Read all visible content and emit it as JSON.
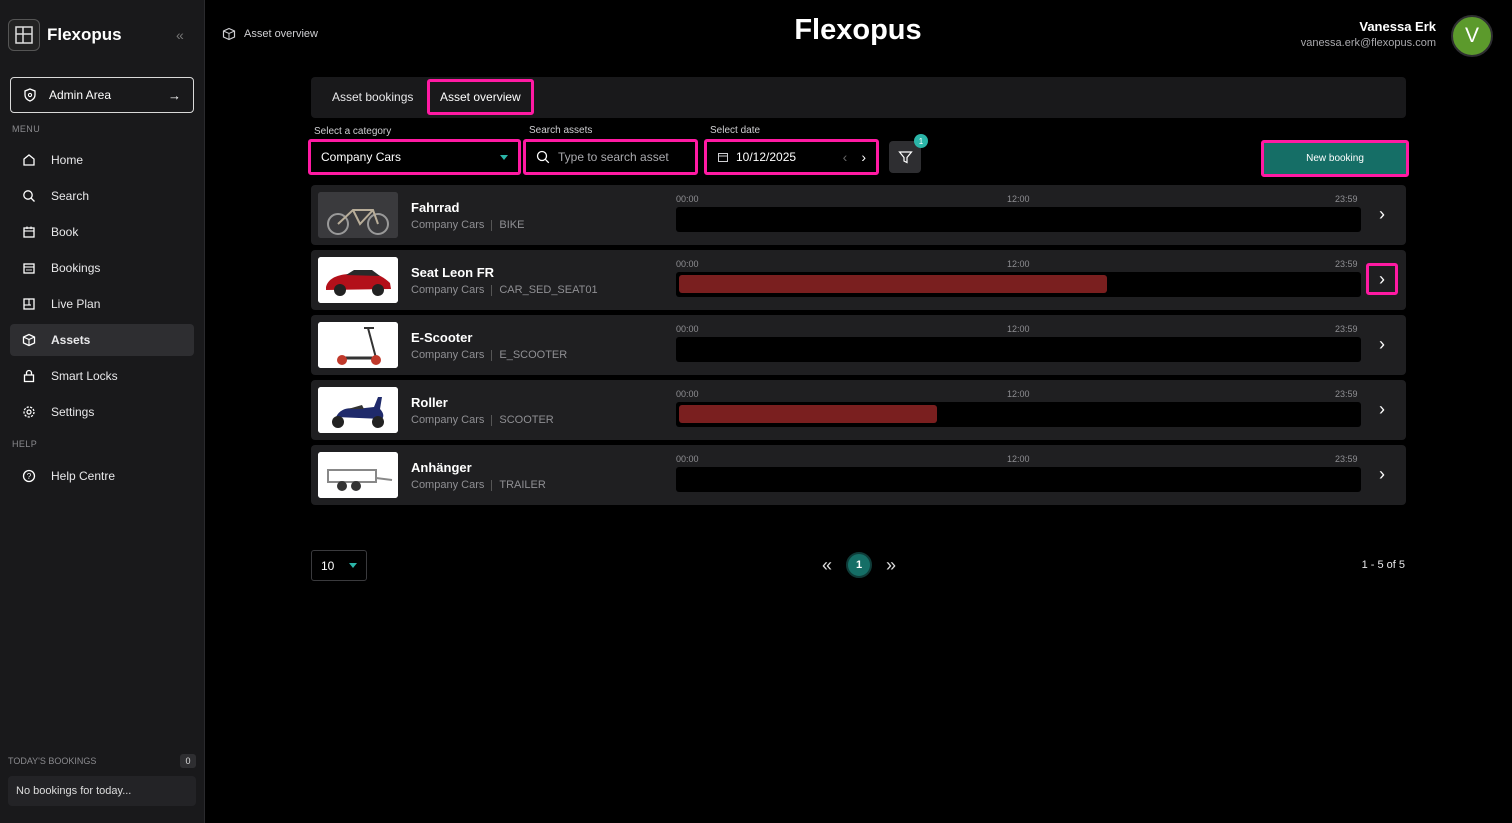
{
  "sidebar": {
    "brand": "Flexopus",
    "admin_label": "Admin Area",
    "menu_label": "MENU",
    "help_label": "HELP",
    "items": [
      {
        "label": "Home",
        "icon": "home-icon"
      },
      {
        "label": "Search",
        "icon": "search-icon"
      },
      {
        "label": "Book",
        "icon": "calendar-plus-icon"
      },
      {
        "label": "Bookings",
        "icon": "calendar-icon"
      },
      {
        "label": "Live Plan",
        "icon": "floorplan-icon"
      },
      {
        "label": "Assets",
        "icon": "box-icon",
        "active": true
      },
      {
        "label": "Smart Locks",
        "icon": "lock-icon"
      },
      {
        "label": "Settings",
        "icon": "gear-icon"
      }
    ],
    "help_item": "Help Centre",
    "todays_bookings_label": "TODAY'S BOOKINGS",
    "todays_bookings_count": "0",
    "no_bookings": "No bookings for today..."
  },
  "header": {
    "breadcrumb": "Asset overview",
    "title": "Flexopus",
    "user_name": "Vanessa Erk",
    "user_email": "vanessa.erk@flexopus.com",
    "avatar_initial": "V"
  },
  "tabs": [
    {
      "label": "Asset bookings"
    },
    {
      "label": "Asset overview",
      "active": true
    }
  ],
  "filters": {
    "category_label": "Select a category",
    "category_value": "Company Cars",
    "search_label": "Search assets",
    "search_placeholder": "Type to search asset",
    "date_label": "Select date",
    "date_value": "10/12/2025",
    "filter_badge": "1",
    "new_booking": "New booking"
  },
  "timeline_labels": {
    "start": "00:00",
    "mid": "12:00",
    "end": "23:59"
  },
  "assets": [
    {
      "name": "Fahrrad",
      "category": "Company Cars",
      "code": "BIKE",
      "booking": null
    },
    {
      "name": "Seat Leon FR",
      "category": "Company Cars",
      "code": "CAR_SED_SEAT01",
      "booking": {
        "start_fraction": 0.0,
        "end_fraction": 0.63
      }
    },
    {
      "name": "E-Scooter",
      "category": "Company Cars",
      "code": "E_SCOOTER",
      "booking": null
    },
    {
      "name": "Roller",
      "category": "Company Cars",
      "code": "SCOOTER",
      "booking": {
        "start_fraction": 0.0,
        "end_fraction": 0.38
      }
    },
    {
      "name": "Anhänger",
      "category": "Company Cars",
      "code": "TRAILER",
      "booking": null
    }
  ],
  "pagination": {
    "per_page": "10",
    "current_page": "1",
    "range": "1 - 5 of 5"
  },
  "colors": {
    "accent": "#156e66",
    "highlight": "#ff1aa3",
    "booking_bar": "#7a1f1f",
    "avatar": "#5c9a2c"
  }
}
